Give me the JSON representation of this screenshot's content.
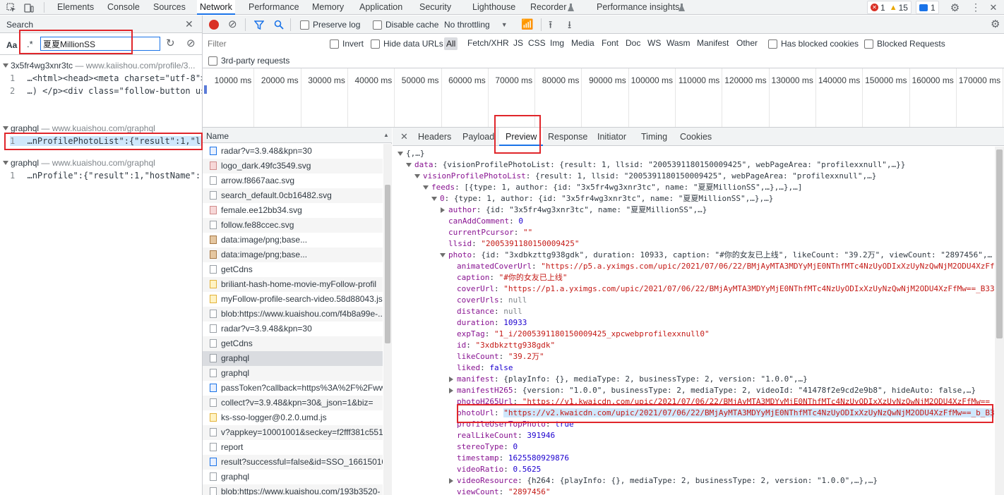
{
  "panel_tabs": [
    "Elements",
    "Console",
    "Sources",
    "Network",
    "Performance",
    "Memory",
    "Application",
    "Security",
    "Lighthouse",
    "Recorder",
    "Performance insights"
  ],
  "badges": {
    "errors": "1",
    "warnings": "15",
    "messages": "1"
  },
  "search": {
    "title": "Search",
    "aa_label": "Aa",
    "regex_label": ".*",
    "query": "夏夏MillionSS",
    "results": [
      {
        "name": "3x5fr4wg3xnr3tc",
        "url": "www.kaiishou.com/profile/3...",
        "lines": [
          {
            "num": "1",
            "text": "…<html><head><meta charset=\"utf-8\"><me…"
          },
          {
            "num": "2",
            "text": "…)   </p><div class=\"follow-button user-info-…"
          }
        ]
      },
      {
        "name": "graphql",
        "url": "www.kuaishou.com/graphql",
        "lines": [
          {
            "num": "1",
            "text": "…nProfilePhotoList\":{\"result\":1,\"llsid\":\"2005391…"
          }
        ]
      },
      {
        "name": "graphql",
        "url": "www.kuaishou.com/graphql",
        "lines": [
          {
            "num": "1",
            "text": "…nProfile\":{\"result\":1,\"hostName\":\"public-xm-k…"
          }
        ]
      }
    ]
  },
  "toolbar": {
    "preserve_log": "Preserve log",
    "disable_cache": "Disable cache",
    "throttling": "No throttling"
  },
  "filter": {
    "placeholder": "Filter",
    "invert": "Invert",
    "hide_data_urls": "Hide data URLs",
    "types": [
      "All",
      "Fetch/XHR",
      "JS",
      "CSS",
      "Img",
      "Media",
      "Font",
      "Doc",
      "WS",
      "Wasm",
      "Manifest",
      "Other"
    ],
    "has_blocked_cookies": "Has blocked cookies",
    "blocked_requests": "Blocked Requests",
    "third_party": "3rd-party requests"
  },
  "timeline_ticks": [
    "10000 ms",
    "20000 ms",
    "30000 ms",
    "40000 ms",
    "50000 ms",
    "60000 ms",
    "70000 ms",
    "80000 ms",
    "90000 ms",
    "100000 ms",
    "110000 ms",
    "120000 ms",
    "130000 ms",
    "140000 ms",
    "150000 ms",
    "160000 ms",
    "170000 ms"
  ],
  "requests": {
    "header": "Name",
    "items": [
      {
        "name": "radar?v=3.9.48&kpn=30",
        "kind": "doc"
      },
      {
        "name": "logo_dark.49fc3549.svg",
        "kind": "img"
      },
      {
        "name": "arrow.f8667aac.svg",
        "kind": "plain"
      },
      {
        "name": "search_default.0cb16482.svg",
        "kind": "plain"
      },
      {
        "name": "female.ee12bb34.svg",
        "kind": "img"
      },
      {
        "name": "follow.fe88ccec.svg",
        "kind": "plain"
      },
      {
        "name": "data:image/png;base...",
        "kind": "pic"
      },
      {
        "name": "data:image/png;base...",
        "kind": "pic"
      },
      {
        "name": "getCdns",
        "kind": "plain"
      },
      {
        "name": "briliant-hash-home-movie-myFollow-profil",
        "kind": "js"
      },
      {
        "name": "myFollow-profile-search-video.58d88043.js",
        "kind": "js"
      },
      {
        "name": "blob:https://www.kuaishou.com/f4b8a99e-...",
        "kind": "plain"
      },
      {
        "name": "radar?v=3.9.48&kpn=30",
        "kind": "plain"
      },
      {
        "name": "getCdns",
        "kind": "plain"
      },
      {
        "name": "graphql",
        "kind": "plain"
      },
      {
        "name": "graphql",
        "kind": "plain"
      },
      {
        "name": "passToken?callback=https%3A%2F%2Fww...",
        "kind": "doc"
      },
      {
        "name": "collect?v=3.9.48&kpn=30&_json=1&biz=",
        "kind": "plain"
      },
      {
        "name": "ks-sso-logger@0.2.0.umd.js",
        "kind": "js"
      },
      {
        "name": "v?appkey=10001001&seckey=f2fff381c551",
        "kind": "plain"
      },
      {
        "name": "report",
        "kind": "plain"
      },
      {
        "name": "result?successful=false&id=SSO_16615010",
        "kind": "doc"
      },
      {
        "name": "graphql",
        "kind": "plain"
      },
      {
        "name": "blob:https://www.kuaishou.com/193b3520-",
        "kind": "plain"
      }
    ]
  },
  "detail_tabs": [
    "Headers",
    "Payload",
    "Preview",
    "Response",
    "Initiator",
    "Timing",
    "Cookies"
  ],
  "preview": [
    {
      "indent": 0,
      "tri": "d",
      "parts": [
        [
          "p",
          "{,…}"
        ]
      ]
    },
    {
      "indent": 1,
      "tri": "d",
      "parts": [
        [
          "k",
          "data"
        ],
        [
          "p",
          ": {visionProfilePhotoList: {result: 1, llsid: \"2005391180150009425\", webPageArea: \"profilexxnull\",…}}"
        ]
      ]
    },
    {
      "indent": 2,
      "tri": "d",
      "parts": [
        [
          "k",
          "visionProfilePhotoList"
        ],
        [
          "p",
          ": {result: 1, llsid: \"2005391180150009425\", webPageArea: \"profilexxnull\",…}"
        ]
      ]
    },
    {
      "indent": 3,
      "tri": "d",
      "parts": [
        [
          "k",
          "feeds"
        ],
        [
          "p",
          ": [{type: 1, author: {id: \"3x5fr4wg3xnr3tc\", name: \"夏夏MillionSS\",…},…},…]"
        ]
      ]
    },
    {
      "indent": 4,
      "tri": "d",
      "parts": [
        [
          "k",
          "0"
        ],
        [
          "p",
          ": {type: 1, author: {id: \"3x5fr4wg3xnr3tc\", name: \"夏夏MillionSS\",…},…}"
        ]
      ]
    },
    {
      "indent": 5,
      "tri": "r",
      "parts": [
        [
          "k",
          "author"
        ],
        [
          "p",
          ": {id: \"3x5fr4wg3xnr3tc\", name: \"夏夏MillionSS\",…}"
        ]
      ]
    },
    {
      "indent": 5,
      "tri": "",
      "parts": [
        [
          "k",
          "canAddComment"
        ],
        [
          "p",
          ": "
        ],
        [
          "n",
          "0"
        ]
      ]
    },
    {
      "indent": 5,
      "tri": "",
      "parts": [
        [
          "k",
          "currentPcursor"
        ],
        [
          "p",
          ": "
        ],
        [
          "s",
          "\"\""
        ]
      ]
    },
    {
      "indent": 5,
      "tri": "",
      "parts": [
        [
          "k",
          "llsid"
        ],
        [
          "p",
          ": "
        ],
        [
          "s",
          "\"2005391180150009425\""
        ]
      ]
    },
    {
      "indent": 5,
      "tri": "d",
      "parts": [
        [
          "k",
          "photo"
        ],
        [
          "p",
          ": {id: \"3xdbkzttg938gdk\", duration: 10933, caption: \"#你的女友已上线\", likeCount: \"39.2万\", viewCount: \"2897456\",…"
        ]
      ]
    },
    {
      "indent": 6,
      "tri": "",
      "parts": [
        [
          "k",
          "animatedCoverUrl"
        ],
        [
          "p",
          ": "
        ],
        [
          "s",
          "\"https://p5.a.yximgs.com/upic/2021/07/06/22/BMjAyMTA3MDYyMjE0NThfMTc4NzUyODIxXzUyNzQwNjM2ODU4XzFfMw"
        ]
      ]
    },
    {
      "indent": 6,
      "tri": "",
      "parts": [
        [
          "k",
          "caption"
        ],
        [
          "p",
          ": "
        ],
        [
          "s",
          "\"#你的女友已上线\""
        ]
      ]
    },
    {
      "indent": 6,
      "tri": "",
      "parts": [
        [
          "k",
          "coverUrl"
        ],
        [
          "p",
          ": "
        ],
        [
          "s",
          "\"https://p1.a.yximgs.com/upic/2021/07/06/22/BMjAyMTA3MDYyMjE0NThfMTc4NzUyODIxXzUyNzQwNjM2ODU4XzFfMw==_B33"
        ]
      ]
    },
    {
      "indent": 6,
      "tri": "",
      "parts": [
        [
          "k",
          "coverUrls"
        ],
        [
          "p",
          ": "
        ],
        [
          "nl",
          "null"
        ]
      ]
    },
    {
      "indent": 6,
      "tri": "",
      "parts": [
        [
          "k",
          "distance"
        ],
        [
          "p",
          ": "
        ],
        [
          "nl",
          "null"
        ]
      ]
    },
    {
      "indent": 6,
      "tri": "",
      "parts": [
        [
          "k",
          "duration"
        ],
        [
          "p",
          ": "
        ],
        [
          "n",
          "10933"
        ]
      ]
    },
    {
      "indent": 6,
      "tri": "",
      "parts": [
        [
          "k",
          "expTag"
        ],
        [
          "p",
          ": "
        ],
        [
          "s",
          "\"1_i/2005391180150009425_xpcwebprofilexxnull0\""
        ]
      ]
    },
    {
      "indent": 6,
      "tri": "",
      "parts": [
        [
          "k",
          "id"
        ],
        [
          "p",
          ": "
        ],
        [
          "s",
          "\"3xdbkzttg938gdk\""
        ]
      ]
    },
    {
      "indent": 6,
      "tri": "",
      "parts": [
        [
          "k",
          "likeCount"
        ],
        [
          "p",
          ": "
        ],
        [
          "s",
          "\"39.2万\""
        ]
      ]
    },
    {
      "indent": 6,
      "tri": "",
      "parts": [
        [
          "k",
          "liked"
        ],
        [
          "p",
          ": "
        ],
        [
          "n",
          "false"
        ]
      ]
    },
    {
      "indent": 6,
      "tri": "r",
      "parts": [
        [
          "k",
          "manifest"
        ],
        [
          "p",
          ": {playInfo: {}, mediaType: 2, businessType: 2, version: \"1.0.0\",…}"
        ]
      ]
    },
    {
      "indent": 6,
      "tri": "r",
      "parts": [
        [
          "k",
          "manifestH265"
        ],
        [
          "p",
          ": {version: \"1.0.0\", businessType: 2, mediaType: 2, videoId: \"41478f2e9cd2e9b8\", hideAuto: false,…}"
        ]
      ]
    },
    {
      "indent": 6,
      "tri": "",
      "parts": [
        [
          "k",
          "photoH265Url"
        ],
        [
          "p",
          ": "
        ],
        [
          "s",
          "\"https://v1.kwaicdn.com/upic/2021/07/06/22/BMjAyMTA3MDYyMjE0NThfMTc4NzUyODIxXzUyNzQwNjM2ODU4XzFfMw=="
        ]
      ]
    },
    {
      "indent": 6,
      "tri": "",
      "parts": [
        [
          "k",
          "photoUrl"
        ],
        [
          "p",
          ": "
        ],
        [
          "s",
          "\"https://v2.kwaicdn.com/upic/2021/07/06/22/BMjAyMTA3MDYyMjE0NThfMTc4NzUyODIxXzUyNzQwNjM2ODU4XzFfMw==_b_B3"
        ]
      ]
    },
    {
      "indent": 6,
      "tri": "",
      "parts": [
        [
          "k",
          "profileUserTopPhoto"
        ],
        [
          "p",
          ": "
        ],
        [
          "n",
          "true"
        ]
      ]
    },
    {
      "indent": 6,
      "tri": "",
      "parts": [
        [
          "k",
          "realLikeCount"
        ],
        [
          "p",
          ": "
        ],
        [
          "n",
          "391946"
        ]
      ]
    },
    {
      "indent": 6,
      "tri": "",
      "parts": [
        [
          "k",
          "stereoType"
        ],
        [
          "p",
          ": "
        ],
        [
          "n",
          "0"
        ]
      ]
    },
    {
      "indent": 6,
      "tri": "",
      "parts": [
        [
          "k",
          "timestamp"
        ],
        [
          "p",
          ": "
        ],
        [
          "n",
          "1625580929876"
        ]
      ]
    },
    {
      "indent": 6,
      "tri": "",
      "parts": [
        [
          "k",
          "videoRatio"
        ],
        [
          "p",
          ": "
        ],
        [
          "n",
          "0.5625"
        ]
      ]
    },
    {
      "indent": 6,
      "tri": "r",
      "parts": [
        [
          "k",
          "videoResource"
        ],
        [
          "p",
          ": {h264: {playInfo: {}, mediaType: 2, businessType: 2, version: \"1.0.0\",…},…}"
        ]
      ]
    },
    {
      "indent": 6,
      "tri": "",
      "parts": [
        [
          "k",
          "viewCount"
        ],
        [
          "p",
          ": "
        ],
        [
          "s",
          "\"2897456\""
        ]
      ]
    }
  ],
  "colors": {
    "accent": "#1a73e8",
    "highlight_box": "#e0262b",
    "record": "#d93025"
  }
}
